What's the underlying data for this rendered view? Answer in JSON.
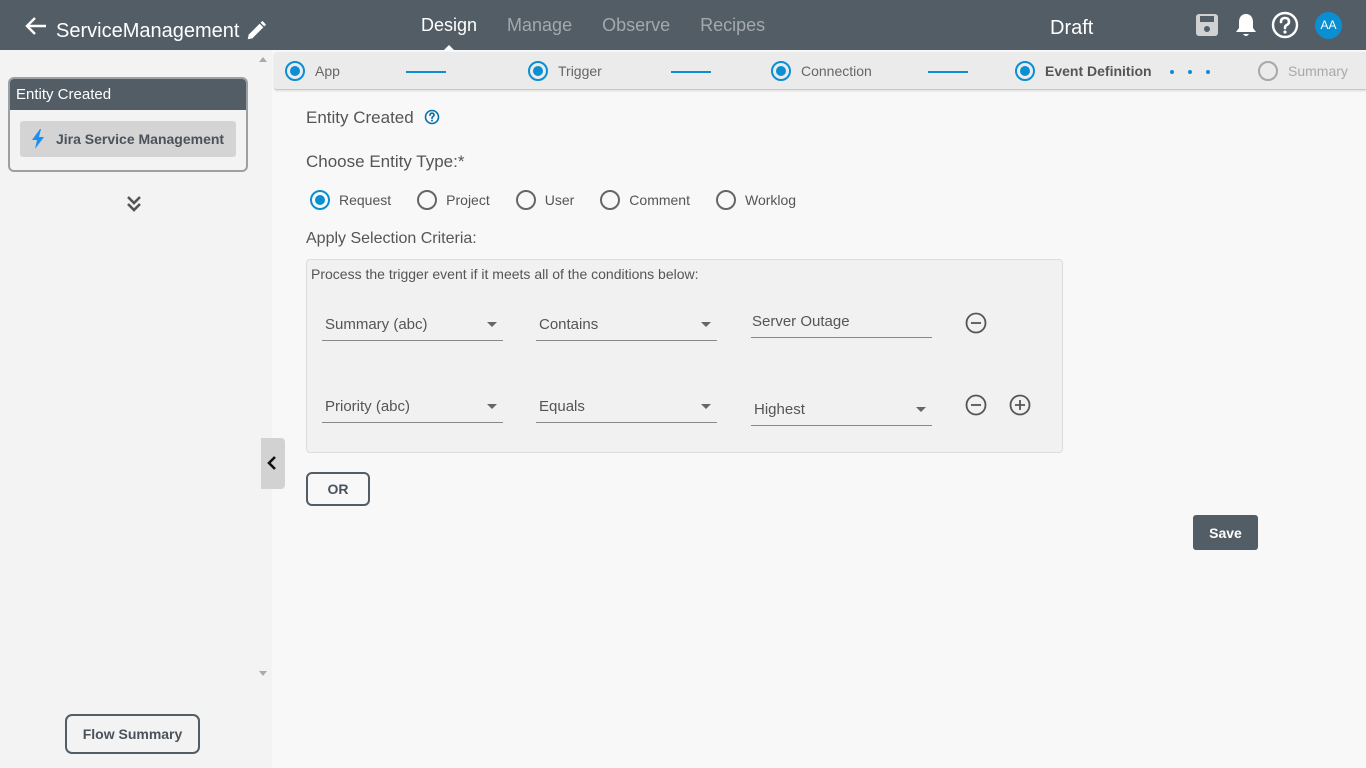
{
  "header": {
    "app_title": "ServiceManagement",
    "nav": [
      {
        "label": "Design",
        "active": true
      },
      {
        "label": "Manage",
        "active": false
      },
      {
        "label": "Observe",
        "active": false
      },
      {
        "label": "Recipes",
        "active": false
      }
    ],
    "status": "Draft",
    "avatar_initials": "AA",
    "icons": [
      "back-arrow-icon",
      "pencil-icon",
      "save-icon",
      "bell-icon",
      "help-icon"
    ]
  },
  "sidebar": {
    "node": {
      "title": "Entity Created",
      "app_name": "Jira Service Management"
    },
    "flow_summary_label": "Flow Summary"
  },
  "stepper": {
    "steps": [
      {
        "label": "App",
        "state": "done"
      },
      {
        "label": "Trigger",
        "state": "done"
      },
      {
        "label": "Connection",
        "state": "done"
      },
      {
        "label": "Event Definition",
        "state": "current"
      },
      {
        "label": "Summary",
        "state": "pending"
      }
    ]
  },
  "form": {
    "title": "Entity Created",
    "entity_type_label": "Choose Entity Type:*",
    "entity_types": [
      {
        "label": "Request",
        "selected": true
      },
      {
        "label": "Project",
        "selected": false
      },
      {
        "label": "User",
        "selected": false
      },
      {
        "label": "Comment",
        "selected": false
      },
      {
        "label": "Worklog",
        "selected": false
      }
    ],
    "criteria_label": "Apply Selection Criteria:",
    "criteria_description": "Process the trigger event if it meets all of the conditions below:",
    "conditions": [
      {
        "field": "Summary (abc)",
        "operator": "Contains",
        "value": "Server Outage",
        "value_type": "text"
      },
      {
        "field": "Priority (abc)",
        "operator": "Equals",
        "value": "Highest",
        "value_type": "select"
      }
    ],
    "or_label": "OR",
    "save_label": "Save"
  },
  "colors": {
    "header_bg": "#525d66",
    "accent": "#0a8fd3",
    "page_bg": "#f8f8f8"
  }
}
